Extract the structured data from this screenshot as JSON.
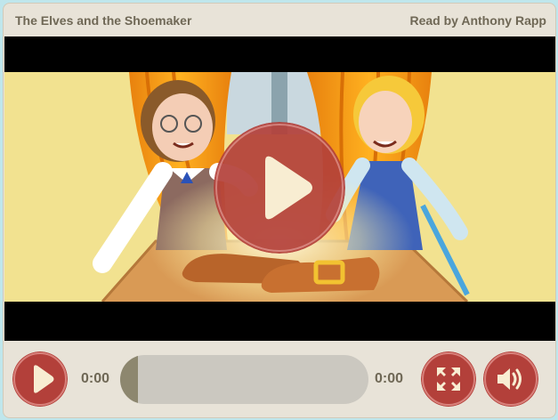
{
  "header": {
    "title": "The Elves and the Shoemaker",
    "narrator": "Read by Anthony Rapp"
  },
  "video": {
    "scene": "story-illustration",
    "big_play_icon": "play-icon"
  },
  "controls": {
    "current_time": "0:00",
    "duration": "0:00",
    "progress": 0,
    "buttons": [
      "play-icon",
      "fullscreen-icon",
      "volume-icon"
    ]
  },
  "colors": {
    "accent": "#b3403a",
    "panel": "#e8e3d8",
    "text": "#6f6856"
  }
}
